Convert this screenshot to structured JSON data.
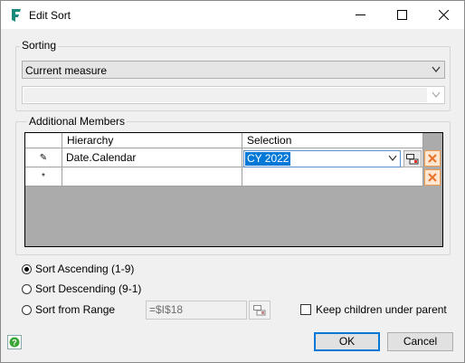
{
  "window": {
    "title": "Edit Sort"
  },
  "sorting": {
    "group_label": "Sorting",
    "measure_select": "Current measure",
    "secondary_select": ""
  },
  "additional_members": {
    "group_label": "Additional Members",
    "columns": [
      "Hierarchy",
      "Selection"
    ],
    "rows": [
      {
        "hierarchy": "Date.Calendar",
        "selection": "CY 2022",
        "indicator": "✎"
      },
      {
        "hierarchy": "",
        "selection": "",
        "indicator": "*"
      }
    ]
  },
  "sort_options": {
    "ascending": "Sort Ascending (1-9)",
    "descending": "Sort Descending (9-1)",
    "from_range": "Sort from Range",
    "selected": "ascending",
    "range_value": "=$I$18"
  },
  "keep_children": {
    "label": "Keep children under parent",
    "checked": false
  },
  "buttons": {
    "ok": "OK",
    "cancel": "Cancel"
  },
  "colors": {
    "accent": "#0078d7",
    "app_icon": "#1a8a7a",
    "delete_icon": "#e8742a"
  }
}
